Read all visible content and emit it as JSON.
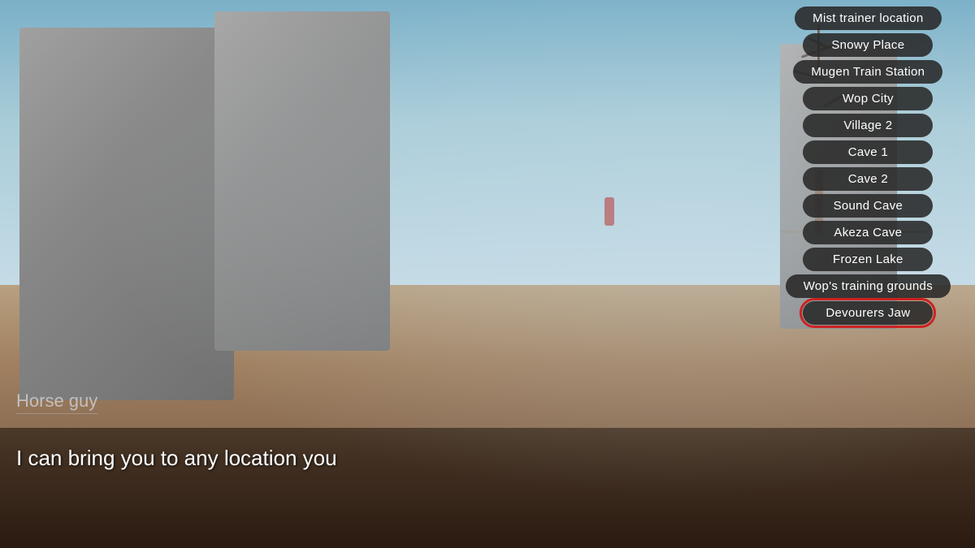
{
  "scene": {
    "character_name": "Horse guy",
    "dialog_text": "I can bring you to any location you"
  },
  "menu": {
    "items": [
      {
        "id": "mist-trainer-location",
        "label": "Mist trainer location",
        "highlighted": false
      },
      {
        "id": "snowy-place",
        "label": "Snowy Place",
        "highlighted": false
      },
      {
        "id": "mugen-train-station",
        "label": "Mugen Train Station",
        "highlighted": false
      },
      {
        "id": "wop-city",
        "label": "Wop City",
        "highlighted": false
      },
      {
        "id": "village-2",
        "label": "Village 2",
        "highlighted": false
      },
      {
        "id": "cave-1",
        "label": "Cave 1",
        "highlighted": false
      },
      {
        "id": "cave-2",
        "label": "Cave 2",
        "highlighted": false
      },
      {
        "id": "sound-cave",
        "label": "Sound Cave",
        "highlighted": false
      },
      {
        "id": "akeza-cave",
        "label": "Akeza Cave",
        "highlighted": false
      },
      {
        "id": "frozen-lake",
        "label": "Frozen Lake",
        "highlighted": false
      },
      {
        "id": "wops-training-grounds",
        "label": "Wop's training grounds",
        "highlighted": false
      },
      {
        "id": "devourers-jaw",
        "label": "Devourers Jaw",
        "highlighted": true
      }
    ]
  }
}
